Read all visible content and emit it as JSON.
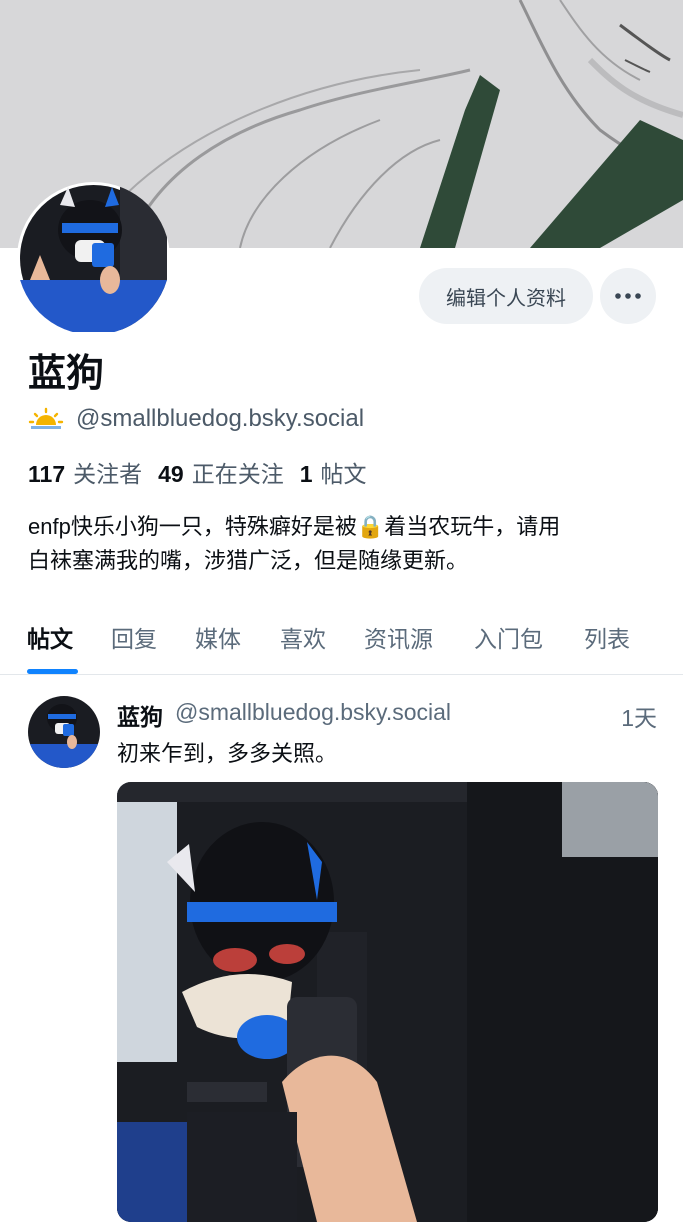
{
  "profile": {
    "display_name": "蓝狗",
    "handle": "@smallbluedog.bsky.social",
    "emoji_icon": "sunrise-icon",
    "edit_label": "编辑个人资料",
    "more_icon": "more-icon",
    "stats": {
      "followers_count": "117",
      "followers_label": "关注者",
      "following_count": "49",
      "following_label": "正在关注",
      "posts_count": "1",
      "posts_label": "帖文"
    },
    "bio_line1": "enfp快乐小狗一只，特殊癖好是被🔒着当农玩牛，请用",
    "bio_line2": "白袜塞满我的嘴，涉猎广泛，但是随缘更新。"
  },
  "tabs": [
    {
      "label": "帖文"
    },
    {
      "label": "回复"
    },
    {
      "label": "媒体"
    },
    {
      "label": "喜欢"
    },
    {
      "label": "资讯源"
    },
    {
      "label": "入门包"
    },
    {
      "label": "列表"
    }
  ],
  "post": {
    "author": "蓝狗",
    "handle": "@smallbluedog.bsky.social",
    "time": "1天",
    "text": "初来乍到，多多关照。"
  },
  "colors": {
    "accent": "#1083fe",
    "muted_text": "#5b6b7b",
    "button_bg": "#eef1f4"
  }
}
